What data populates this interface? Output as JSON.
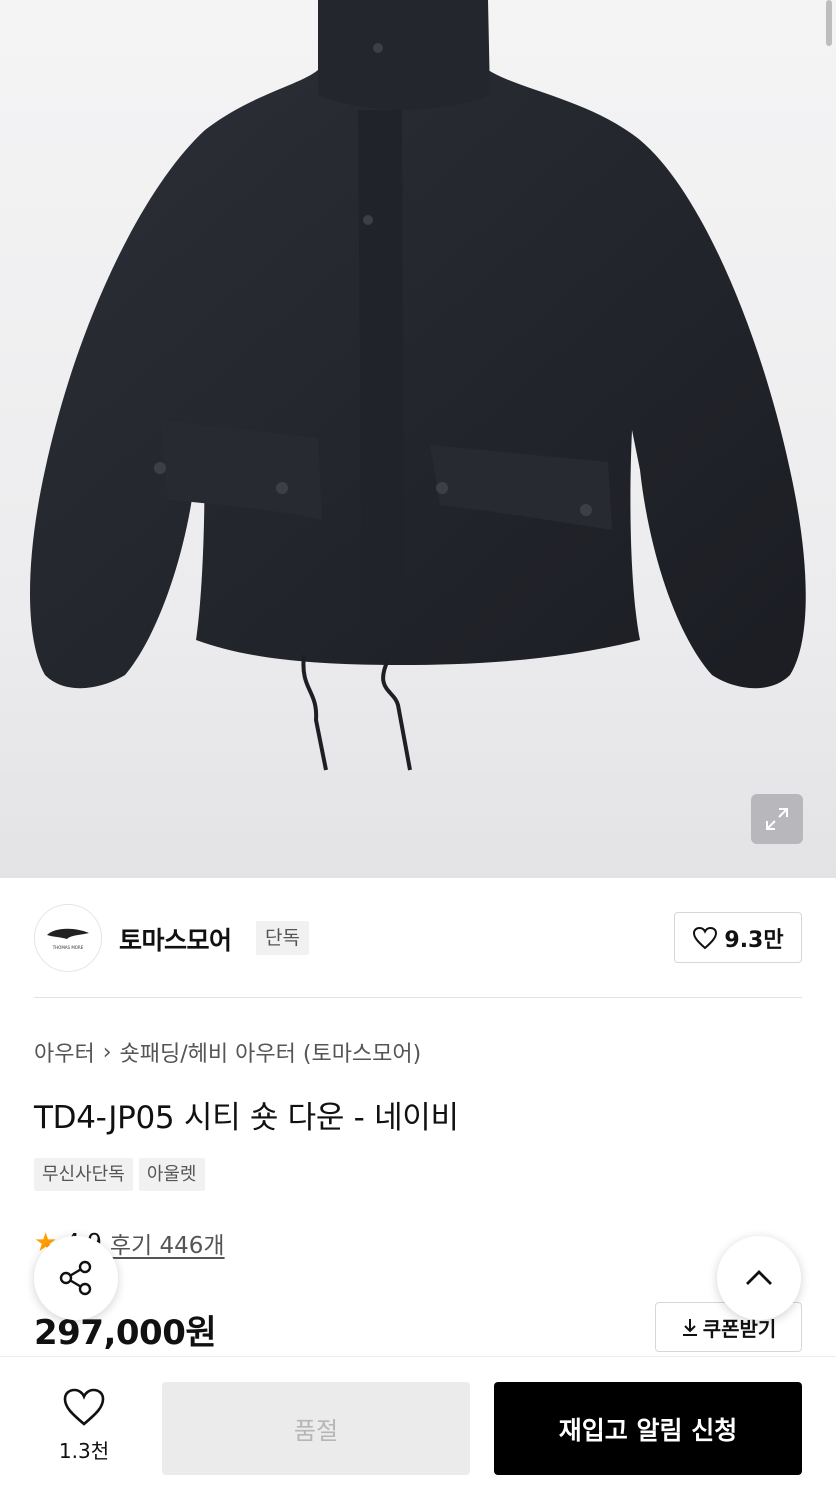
{
  "product_image": {
    "alt": ""
  },
  "brand": {
    "name": "토마스모어",
    "badge": "단독",
    "likes": "9.3만",
    "logo_text": "THOMAS MORE"
  },
  "breadcrumb": {
    "category": "아우터",
    "subcategory": "숏패딩/헤비 아우터 (토마스모어)"
  },
  "product": {
    "title": "TD4-JP05 시티 숏 다운 - 네이비",
    "tags": [
      "무신사단독",
      "아울렛"
    ]
  },
  "rating": {
    "score": "4.9",
    "reviews_label": "후기 446개"
  },
  "price": {
    "amount": "297,000원",
    "coupon_label": "쿠폰받기"
  },
  "bottom_bar": {
    "wish_count": "1.3천",
    "soldout_label": "품절",
    "restock_label": "재입고 알림 신청"
  },
  "icons": [
    "expand-icon",
    "heart-icon",
    "share-icon",
    "chevron-up-icon",
    "download-icon",
    "star-icon"
  ],
  "colors": {
    "accent_star": "#ff9f00",
    "primary_button": "#000000",
    "disabled_button": "#ebebeb"
  }
}
